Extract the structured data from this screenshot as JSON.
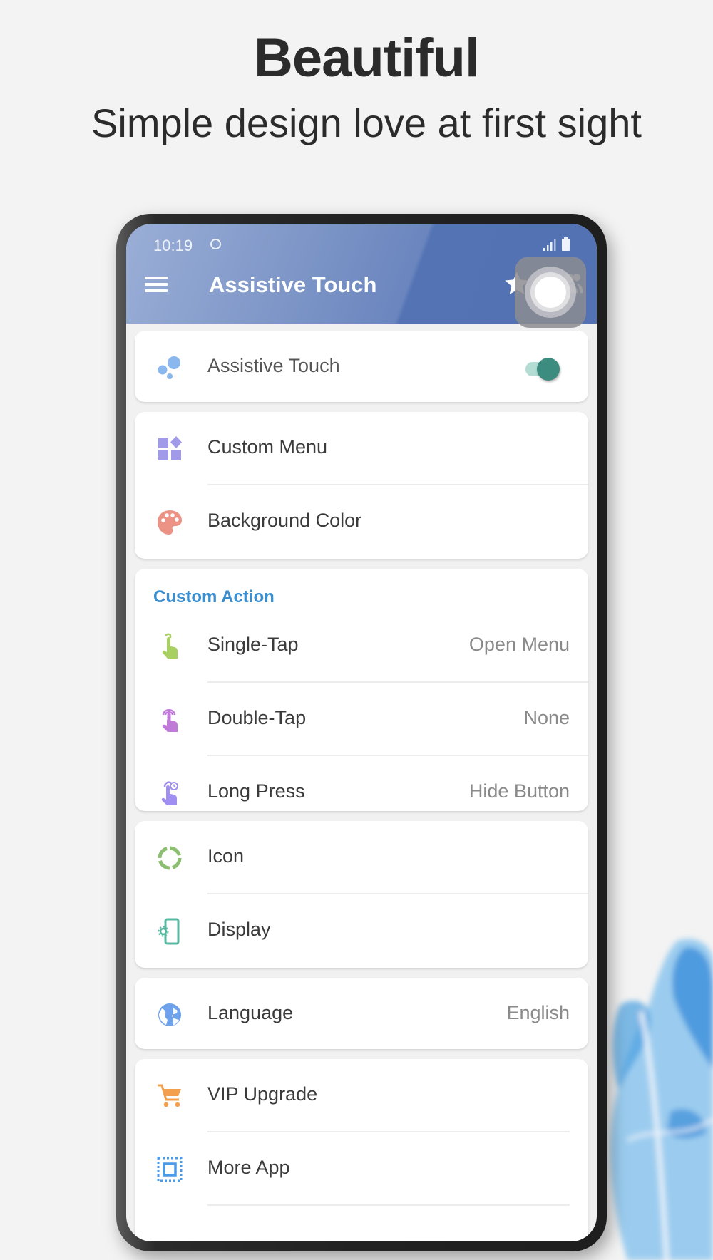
{
  "promo": {
    "headline": "Beautiful",
    "subline": "Simple design love at first sight"
  },
  "status_bar": {
    "time": "10:19",
    "icons": [
      "circle-notification-icon",
      "signal-icon",
      "battery-icon"
    ]
  },
  "app_bar": {
    "title": "Assistive Touch",
    "icons": [
      "menu-icon",
      "star-icon",
      "add-person-icon"
    ]
  },
  "colors": {
    "app_bar": "#5272b3",
    "accent_toggle": "#3c8d7f",
    "section_title": "#3a8fd0",
    "background": "#f3f3f3"
  },
  "cards": {
    "main_toggle": {
      "label": "Assistive Touch",
      "icon": "bubbles-icon",
      "enabled": true
    },
    "appearance": [
      {
        "label": "Custom Menu",
        "icon": "widgets-icon"
      },
      {
        "label": "Background Color",
        "icon": "palette-icon"
      }
    ],
    "custom_action": {
      "title": "Custom Action",
      "items": [
        {
          "label": "Single-Tap",
          "value": "Open Menu",
          "icon": "single-tap-icon"
        },
        {
          "label": "Double-Tap",
          "value": "None",
          "icon": "double-tap-icon"
        },
        {
          "label": "Long Press",
          "value": "Hide Button",
          "icon": "long-press-icon"
        }
      ]
    },
    "settings": [
      {
        "label": "Icon",
        "icon": "ring-icon"
      },
      {
        "label": "Display",
        "icon": "display-settings-icon"
      }
    ],
    "language": {
      "label": "Language",
      "value": "English",
      "icon": "globe-icon"
    },
    "more": [
      {
        "label": "VIP Upgrade",
        "icon": "cart-icon"
      },
      {
        "label": "More App",
        "icon": "select-all-icon"
      }
    ]
  },
  "floating_button": {
    "icon": "assistive-touch-icon"
  }
}
